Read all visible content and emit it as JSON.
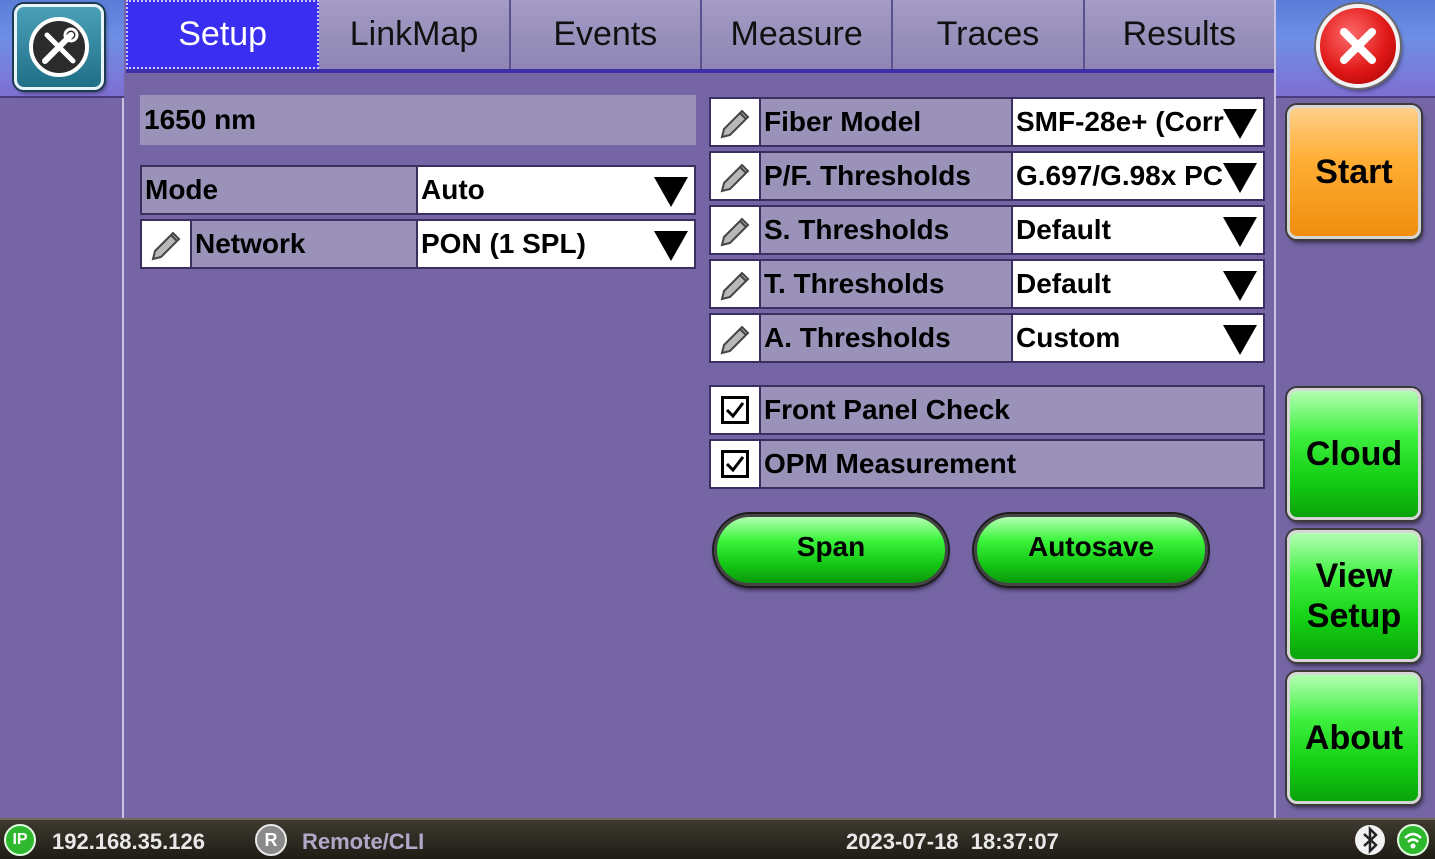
{
  "tabs": [
    {
      "label": "Setup",
      "active": true
    },
    {
      "label": "LinkMap",
      "active": false
    },
    {
      "label": "Events",
      "active": false
    },
    {
      "label": "Measure",
      "active": false
    },
    {
      "label": "Traces",
      "active": false
    },
    {
      "label": "Results",
      "active": false
    }
  ],
  "left": {
    "wavelength": "1650 nm",
    "mode": {
      "label": "Mode",
      "value": "Auto"
    },
    "network": {
      "label": "Network",
      "value": "PON (1 SPL)"
    }
  },
  "settings": [
    {
      "label": "Fiber Model",
      "value": "SMF-28e+ (Corr"
    },
    {
      "label": "P/F. Thresholds",
      "value": "G.697/G.98x PC"
    },
    {
      "label": "S. Thresholds",
      "value": "Default"
    },
    {
      "label": "T. Thresholds",
      "value": "Default"
    },
    {
      "label": "A. Thresholds",
      "value": "Custom"
    }
  ],
  "checks": [
    {
      "label": "Front Panel Check",
      "checked": true
    },
    {
      "label": "OPM Measurement",
      "checked": true
    }
  ],
  "buttons": {
    "span": "Span",
    "autosave": "Autosave"
  },
  "side": {
    "start": "Start",
    "cloud": "Cloud",
    "view_setup_line1": "View",
    "view_setup_line2": "Setup",
    "about": "About"
  },
  "status": {
    "ip_badge": "IP",
    "ip": "192.168.35.126",
    "remote_badge": "R",
    "remote": "Remote/CLI",
    "datetime": "2023-07-18  18:37:07"
  },
  "colors": {
    "background": "#7565a5",
    "active_tab": "#3a2ef0",
    "start_button": "#ffae35",
    "green_button": "#14cf14",
    "close_button": "#e01818"
  },
  "icons": [
    "tools-icon",
    "close-icon",
    "pencil-icon",
    "checkmark-icon",
    "bluetooth-icon",
    "wifi-icon"
  ]
}
